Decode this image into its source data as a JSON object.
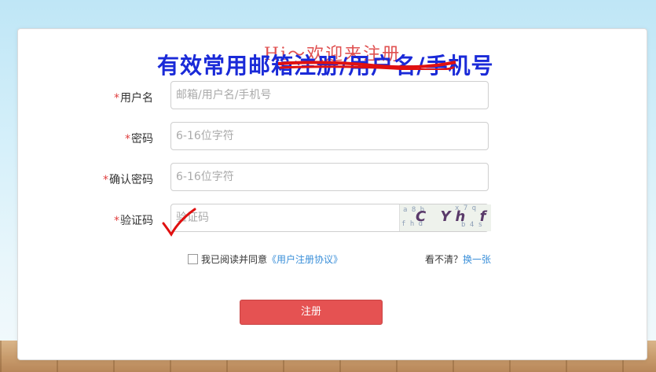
{
  "form": {
    "title": "Hi～欢迎来注册",
    "required_mark": "*",
    "username": {
      "label": "用户名",
      "placeholder": "邮箱/用户名/手机号"
    },
    "password": {
      "label": "密码",
      "placeholder": "6-16位字符"
    },
    "confirm_password": {
      "label": "确认密码",
      "placeholder": "6-16位字符"
    },
    "captcha": {
      "label": "验证码",
      "placeholder": "验证码",
      "image_text": "C Yh f"
    },
    "agree": {
      "text": "我已阅读并同意",
      "link": "《用户注册协议》"
    },
    "refresh": {
      "prefix": "看不清？",
      "link": "换一张"
    },
    "submit_label": "注册"
  },
  "annotation": {
    "text": "有效常用邮箱注册/用户名/手机号",
    "color": "#1a2ad8"
  },
  "colors": {
    "accent": "#e55252",
    "link": "#3a8fd9",
    "title": "#e05050"
  }
}
